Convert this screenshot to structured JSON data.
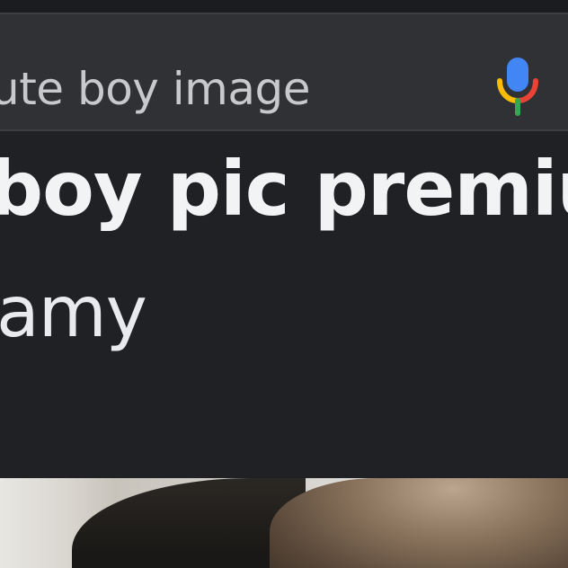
{
  "search": {
    "query": "ute boy image"
  },
  "result": {
    "title": "boy pic premium",
    "source": "amy"
  },
  "colors": {
    "page_bg": "#202124",
    "search_bg": "#303134",
    "text_primary": "#f1f3f4",
    "mic_blue": "#4285f4",
    "mic_red": "#ea4335",
    "mic_yellow": "#fbbc04",
    "mic_green": "#34a853"
  },
  "icons": {
    "mic": "microphone-icon"
  }
}
